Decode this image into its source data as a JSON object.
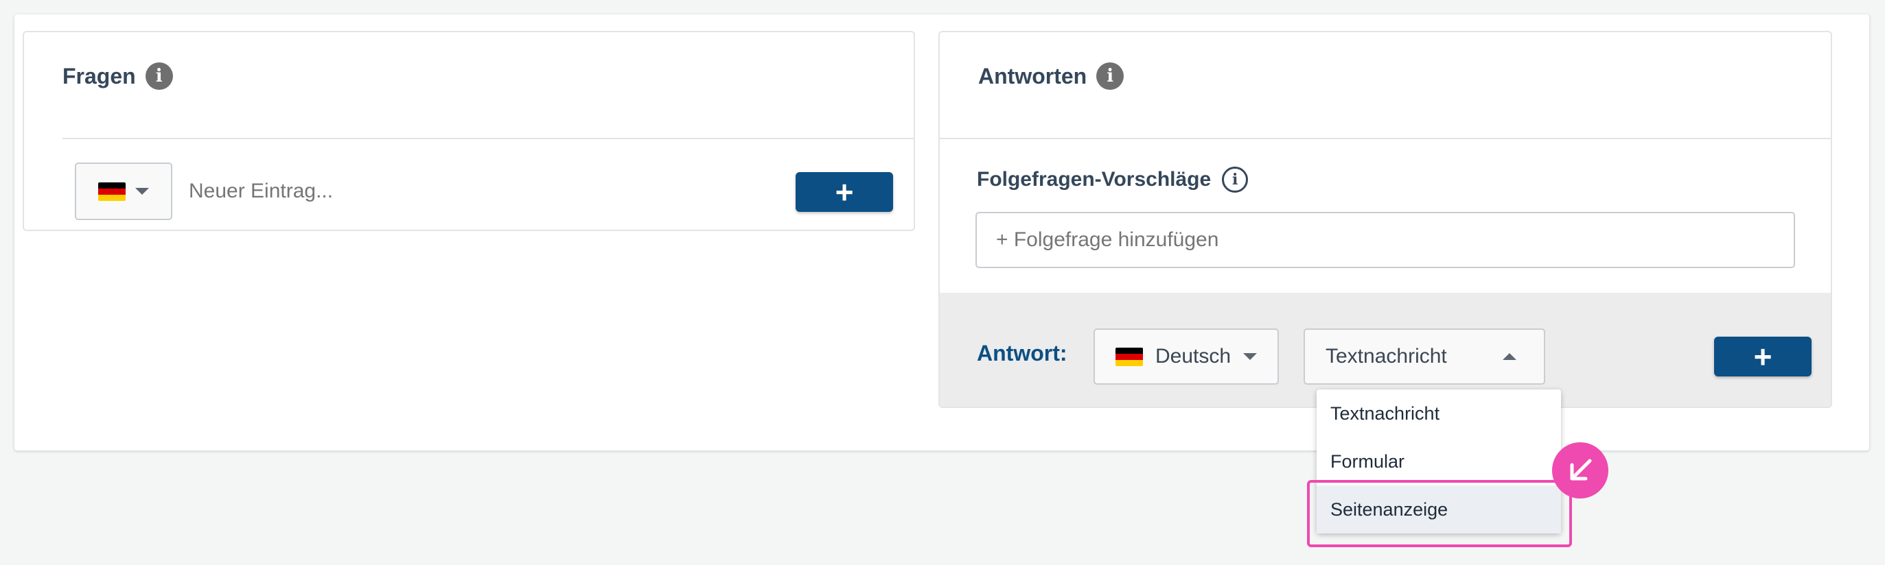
{
  "questions": {
    "title": "Fragen",
    "language_flag": "de-flag-icon",
    "entry_placeholder": "Neuer Eintrag...",
    "add_label": "+"
  },
  "answers": {
    "title": "Antworten",
    "followup_label": "Folgefragen-Vorschläge",
    "followup_placeholder": "+ Folgefrage hinzufügen",
    "answer_label": "Antwort:",
    "language_selected": "Deutsch",
    "type_selected": "Textnachricht",
    "add_label": "+"
  },
  "type_dropdown": {
    "options": [
      "Textnachricht",
      "Formular",
      "Seitenanzeige"
    ],
    "hovered_index": 2
  },
  "colors": {
    "accent": "#0b4f84",
    "highlight": "#ee4aaf"
  }
}
